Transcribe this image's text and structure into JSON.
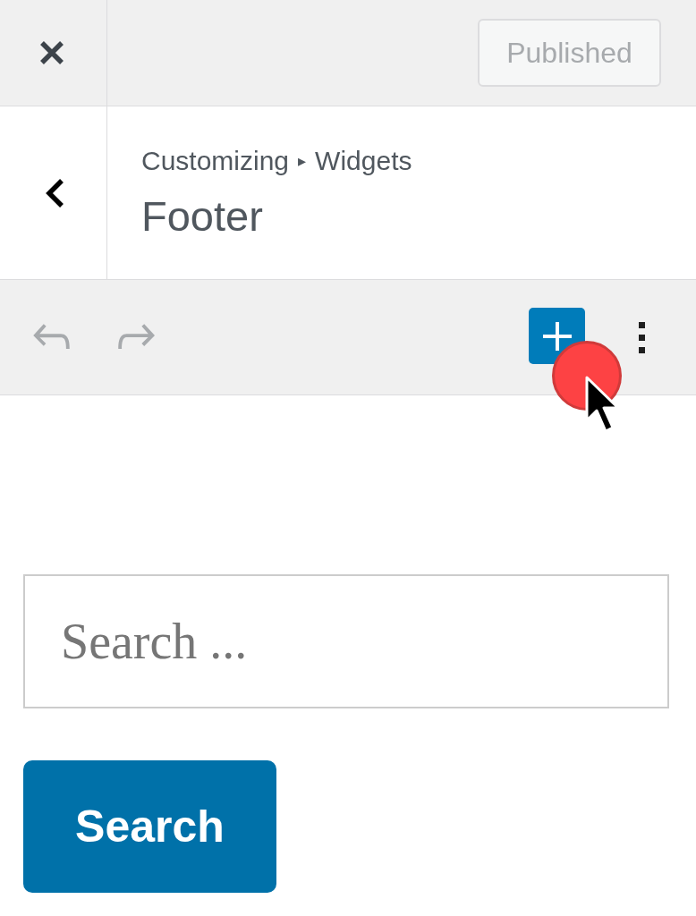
{
  "top_bar": {
    "publish_button": {
      "label": "Published",
      "disabled": true
    }
  },
  "panel_header": {
    "breadcrumb": {
      "items": [
        "Customizing",
        "Widgets"
      ],
      "separator": "▸"
    },
    "title": "Footer"
  },
  "toolbar": {
    "undo": {
      "disabled": true
    },
    "redo": {
      "disabled": true
    }
  },
  "search_widget": {
    "placeholder": "Search ...",
    "button": "Search"
  }
}
